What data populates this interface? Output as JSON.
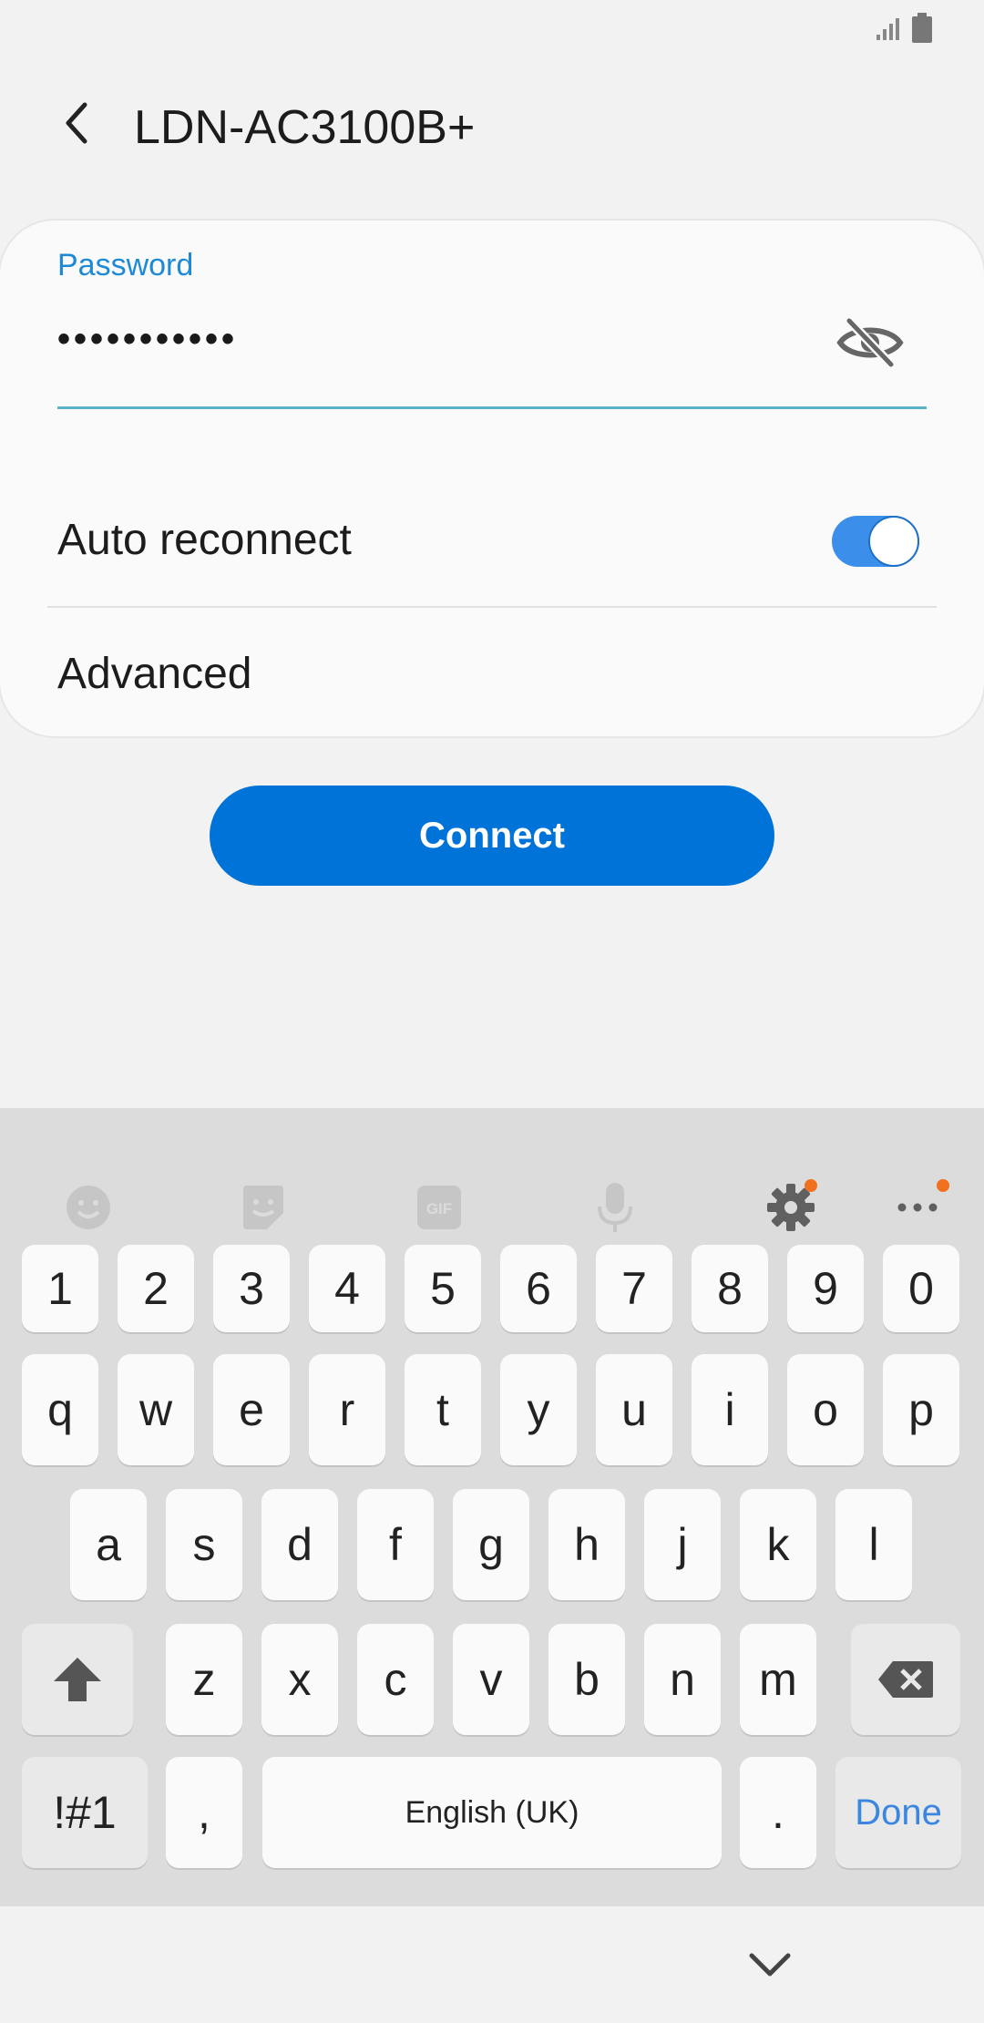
{
  "header": {
    "title": "LDN-AC3100B+"
  },
  "password": {
    "label": "Password",
    "value": "•••••••••••"
  },
  "auto_reconnect": {
    "label": "Auto reconnect",
    "enabled": true
  },
  "advanced": {
    "label": "Advanced"
  },
  "connect_button": {
    "label": "Connect"
  },
  "keyboard": {
    "toolbar_icons": [
      "emoji-icon",
      "sticker-icon",
      "gif-icon",
      "microphone-icon",
      "settings-icon",
      "more-options-icon"
    ],
    "row_numbers": [
      "1",
      "2",
      "3",
      "4",
      "5",
      "6",
      "7",
      "8",
      "9",
      "0"
    ],
    "row_top": [
      "q",
      "w",
      "e",
      "r",
      "t",
      "y",
      "u",
      "i",
      "o",
      "p"
    ],
    "row_middle": [
      "a",
      "s",
      "d",
      "f",
      "g",
      "h",
      "j",
      "k",
      "l"
    ],
    "row_bottom": [
      "z",
      "x",
      "c",
      "v",
      "b",
      "n",
      "m"
    ],
    "symbols_key": "!#1",
    "comma_key": ",",
    "space_key": "English (UK)",
    "period_key": ".",
    "done_key": "Done"
  },
  "colors": {
    "accent_blue": "#0073d9",
    "label_blue": "#1e8ad6",
    "toggle_on": "#3b8eea",
    "notification_dot": "#f07020"
  }
}
